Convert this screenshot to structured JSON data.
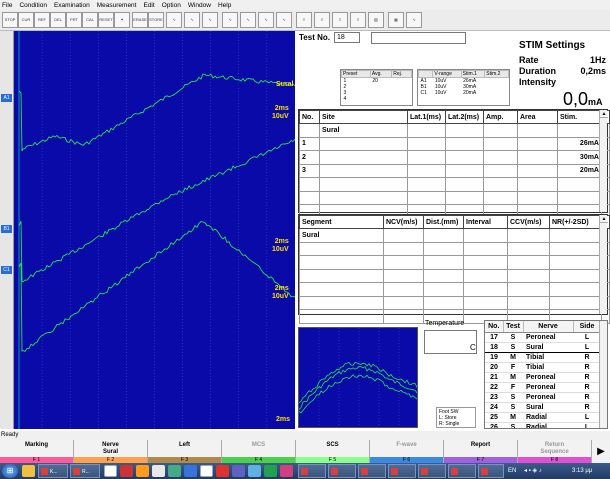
{
  "menu": [
    "File",
    "Condition",
    "Examination",
    "Measurement",
    "Edit",
    "Option",
    "Window",
    "Help"
  ],
  "toolbar": {
    "buttons": [
      {
        "name": "stop-icon",
        "text": "STOP"
      },
      {
        "name": "cursor-icon",
        "text": "CUR"
      },
      {
        "name": "ref-icon",
        "text": "REF"
      },
      {
        "name": "del-icon",
        "text": "DEL"
      },
      {
        "name": "print-icon",
        "text": "PRT"
      },
      {
        "name": "cal-icon",
        "text": "CAL"
      },
      {
        "name": "reset-icon",
        "text": "RESET"
      },
      {
        "name": "star-icon",
        "text": "✶"
      },
      {
        "name": "erase-icon",
        "text": "ERASE"
      },
      {
        "name": "store-icon",
        "text": "STORE"
      },
      {
        "name": "waveform-1-icon",
        "text": "∿"
      },
      {
        "name": "waveform-2-icon",
        "text": "∿"
      },
      {
        "name": "waveform-3-icon",
        "text": "∿"
      },
      {
        "name": "waveform-4-icon",
        "text": "∿"
      },
      {
        "name": "waveform-5-icon",
        "text": "∿"
      },
      {
        "name": "waveform-6-icon",
        "text": "∿"
      },
      {
        "name": "waveform-7-icon",
        "text": "∿"
      },
      {
        "name": "list-1-icon",
        "text": "≡"
      },
      {
        "name": "list-2-icon",
        "text": "≡"
      },
      {
        "name": "list-3-icon",
        "text": "≡"
      },
      {
        "name": "list-4-icon",
        "text": "≡"
      },
      {
        "name": "hatch-icon",
        "text": "▨"
      },
      {
        "name": "grid-icon",
        "text": "▦"
      },
      {
        "name": "signal-icon",
        "text": "∿"
      }
    ]
  },
  "channels": [
    {
      "label": "A1",
      "name": "Sural",
      "scale": "2ms\n10uV"
    },
    {
      "label": "B1",
      "name": "",
      "scale": "2ms\n10uV"
    },
    {
      "label": "C1",
      "name": "",
      "scale": "2ms\n10uV"
    },
    {
      "label": "",
      "name": "",
      "scale": "2ms"
    }
  ],
  "test": {
    "label": "Test No.",
    "number": "18"
  },
  "stim": {
    "title": "STIM Settings",
    "rate_label": "Rate",
    "rate_value": "1Hz",
    "duration_label": "Duration",
    "duration_value": "0,2ms",
    "intensity_label": "Intensity",
    "intensity_value": "0,0",
    "intensity_unit": "mA"
  },
  "preset_table": {
    "headers": [
      "Preset",
      "Avg.",
      "Rej."
    ],
    "rows": [
      [
        "1",
        "20",
        ""
      ],
      [
        "2",
        "",
        ""
      ],
      [
        "3",
        "",
        ""
      ],
      [
        "4",
        "",
        ""
      ]
    ]
  },
  "vrange_table": {
    "headers": [
      "V-range",
      "Stim.1",
      "Stim.2"
    ],
    "rows": [
      [
        "A1",
        "10uV",
        "26mA",
        ""
      ],
      [
        "B1",
        "10uV",
        "30mA",
        ""
      ],
      [
        "C1",
        "10uV",
        "20mA",
        ""
      ]
    ]
  },
  "site_table": {
    "headers": [
      "No.",
      "Site",
      "Lat.1(ms)",
      "Lat.2(ms)",
      "Amp.",
      "Area",
      "Stim."
    ],
    "rows": [
      [
        "",
        "Sural",
        "",
        "",
        "",
        "",
        ""
      ],
      [
        "1",
        "",
        "",
        "",
        "",
        "",
        "26mA"
      ],
      [
        "2",
        "",
        "",
        "",
        "",
        "",
        "30mA"
      ],
      [
        "3",
        "",
        "",
        "",
        "",
        "",
        "20mA"
      ],
      [
        "",
        "",
        "",
        "",
        "",
        "",
        ""
      ],
      [
        "",
        "",
        "",
        "",
        "",
        "",
        ""
      ],
      [
        "",
        "",
        "",
        "",
        "",
        "",
        ""
      ]
    ]
  },
  "segment_table": {
    "headers": [
      "Segment",
      "NCV(m/s)",
      "Dist.(mm)",
      "Interval",
      "CCV(m/s)",
      "NR(+/-2SD)"
    ],
    "rows": [
      [
        "Sural",
        "",
        "",
        "",
        "",
        ""
      ],
      [
        "",
        "",
        "",
        "",
        "",
        ""
      ],
      [
        "",
        "",
        "",
        "",
        "",
        ""
      ],
      [
        "",
        "",
        "",
        "",
        "",
        ""
      ],
      [
        "",
        "",
        "",
        "",
        "",
        ""
      ],
      [
        "",
        "",
        "",
        "",
        "",
        ""
      ],
      [
        "",
        "",
        "",
        "",
        "",
        ""
      ]
    ]
  },
  "temperature": {
    "label": "Temperature",
    "unit": "C"
  },
  "footsw": {
    "title": "Foot SW",
    "line1": "L: Store",
    "line2": "R: Single"
  },
  "test_list": {
    "headers": [
      "No.",
      "Test",
      "Nerve",
      "Side"
    ],
    "rows": [
      [
        "17",
        "S",
        "Peroneal",
        "L"
      ],
      [
        "18",
        "S",
        "Sural",
        "L"
      ],
      [
        "19",
        "M",
        "Tibial",
        "R"
      ],
      [
        "20",
        "F",
        "Tibial",
        "R"
      ],
      [
        "21",
        "M",
        "Peroneal",
        "R"
      ],
      [
        "22",
        "F",
        "Peroneal",
        "R"
      ],
      [
        "23",
        "S",
        "Peroneal",
        "R"
      ],
      [
        "24",
        "S",
        "Sural",
        "R"
      ],
      [
        "25",
        "M",
        "Radial",
        "L"
      ],
      [
        "26",
        "S",
        "Radial",
        "L"
      ]
    ],
    "selected_index": 1
  },
  "status": "Ready",
  "fkeys": [
    {
      "label": "Marking",
      "key": "F 1",
      "color": "#ff5a9c",
      "enabled": true
    },
    {
      "label": "Nerve\nSural",
      "key": "F 2",
      "color": "#ffa04a",
      "enabled": true
    },
    {
      "label": "Left",
      "key": "F 3",
      "color": "#b08a4a",
      "enabled": true
    },
    {
      "label": "MCS",
      "key": "F 4",
      "color": "#4ad04a",
      "enabled": false
    },
    {
      "label": "SCS",
      "key": "F 5",
      "color": "#8aff8a",
      "enabled": true
    },
    {
      "label": "F-wave",
      "key": "F 6",
      "color": "#3a8ae0",
      "enabled": false
    },
    {
      "label": "Report",
      "key": "F 7",
      "color": "#a060e0",
      "enabled": true
    },
    {
      "label": "Return\nSequence",
      "key": "F 8",
      "color": "#e050d0",
      "enabled": false
    }
  ],
  "taskbar": {
    "language": "EN",
    "clock": "3:13 μμ",
    "tasks": [
      {
        "text": "K..."
      },
      {
        "text": "R..."
      }
    ]
  },
  "colors": {
    "plot_bg": "#0a0aa8",
    "trace": "#29e04a",
    "label_yellow": "#ffe000"
  }
}
